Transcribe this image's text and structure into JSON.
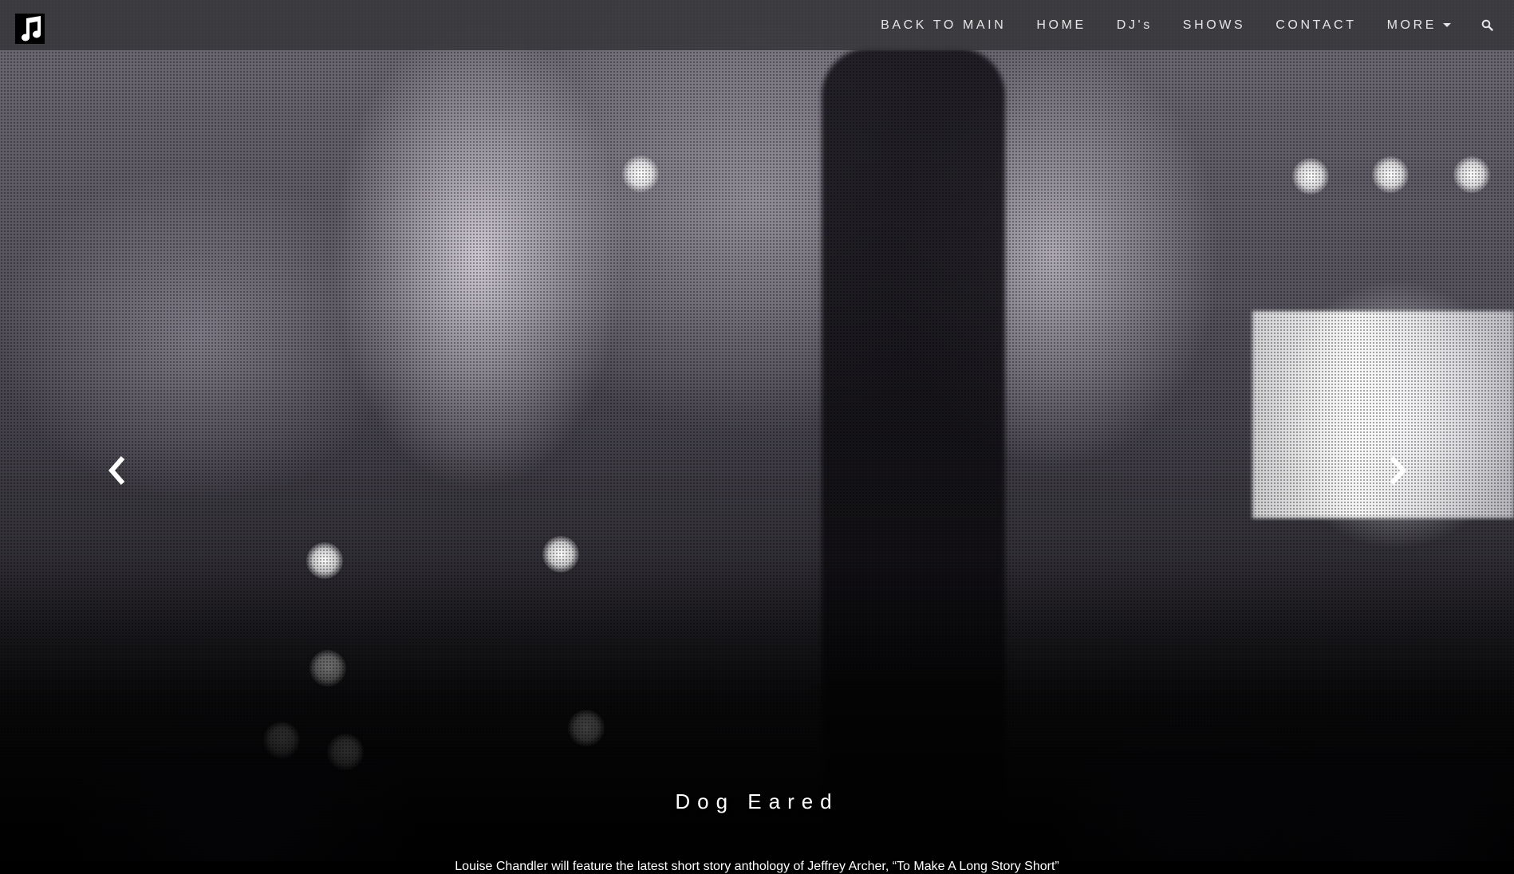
{
  "navbar": {
    "logo_icon": "music-note-icon",
    "items": [
      {
        "label": "BACK TO MAIN"
      },
      {
        "label": "HOME"
      },
      {
        "label": "DJ's"
      },
      {
        "label": "SHOWS"
      },
      {
        "label": "CONTACT"
      },
      {
        "label": "MORE",
        "has_dropdown": true
      }
    ],
    "search_icon": "search-icon"
  },
  "carousel": {
    "prev_icon": "chevron-left-icon",
    "next_icon": "chevron-right-icon",
    "slide": {
      "title": "Dog Eared",
      "text": "Louise Chandler will feature the latest short story anthology of Jeffrey Archer, “To Make A Long Story Short”"
    }
  },
  "colors": {
    "navbar_bg": "#37373a",
    "nav_text": "#e6e6e6",
    "caption_text": "#ffffff"
  }
}
